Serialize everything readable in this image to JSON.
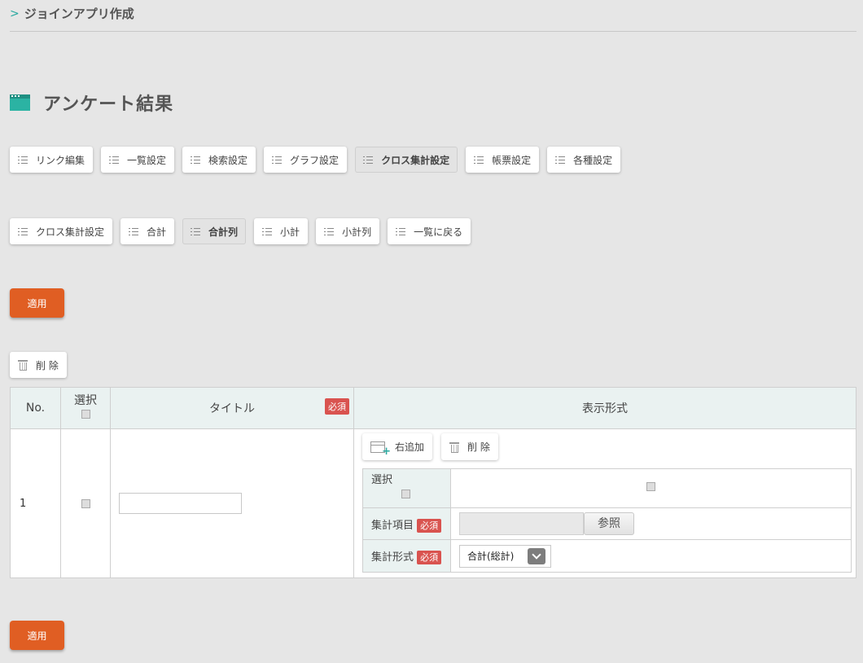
{
  "breadcrumb": {
    "label": "ジョインアプリ作成"
  },
  "page": {
    "title": "アンケート結果"
  },
  "nav_row1": [
    {
      "label": "リンク編集",
      "active": false
    },
    {
      "label": "一覧設定",
      "active": false
    },
    {
      "label": "検索設定",
      "active": false
    },
    {
      "label": "グラフ設定",
      "active": false
    },
    {
      "label": "クロス集計設定",
      "active": true
    },
    {
      "label": "帳票設定",
      "active": false
    },
    {
      "label": "各種設定",
      "active": false
    }
  ],
  "nav_row2": [
    {
      "label": "クロス集計設定",
      "active": false
    },
    {
      "label": "合計",
      "active": false
    },
    {
      "label": "合計列",
      "active": true
    },
    {
      "label": "小計",
      "active": false
    },
    {
      "label": "小計列",
      "active": false
    },
    {
      "label": "一覧に戻る",
      "active": false
    }
  ],
  "actions": {
    "apply_label": "適用",
    "delete_label": "削 除"
  },
  "table": {
    "headers": {
      "no": "No.",
      "select": "選択",
      "title": "タイトル",
      "required": "必須",
      "display": "表示形式"
    },
    "rows": [
      {
        "no": "1",
        "title_value": "",
        "add_right_label": "右追加",
        "delete_label": "削 除",
        "inner": {
          "select_label": "選択",
          "item_label": "集計項目",
          "required": "必須",
          "browse_label": "参照",
          "format_label": "集計形式",
          "format_value": "合計(総計)"
        }
      }
    ]
  }
}
